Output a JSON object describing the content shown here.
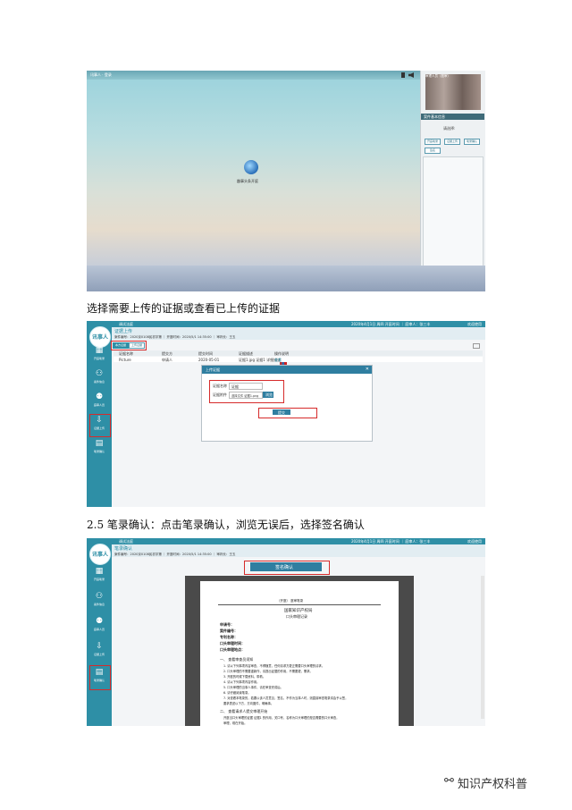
{
  "shot1": {
    "window_title": "讯事人 · 登录",
    "panel_user": "审理人员（庭审）",
    "panel_title": "案件基本信息",
    "panel_label": "请选择:",
    "btn_a": "开庭笔录",
    "btn_b": "证据上传",
    "btn_c": "笔录确认",
    "btn_d": "签名",
    "desktop_icon_label": "趣事头条开庭"
  },
  "caption1": "选择需要上传的证据或查看已上传的证据",
  "shot2": {
    "app_logo": "讯事人",
    "header_tab": "调试法庭",
    "header_right_info": "2020年4月1日 周四 开庭时间 ｜ 庭审人：张三丰",
    "header_user": "欢迎使用",
    "page_title": "证据上传",
    "case_info": "案件编号：2020京0108民初字第 ｜ 开庭时间：2020/5/1 14:35:00 ｜ 审判长：王五",
    "btn_my_evidence": "本方证据",
    "btn_upload": "上传证据",
    "table_headers": [
      "证据名称",
      "提交方",
      "提交时间",
      "证据描述",
      "操作说明"
    ],
    "table_row": [
      "Picture",
      "申请人",
      "2020-05-01",
      "证据1.jpg 证据1 详细描述",
      "查看"
    ],
    "modal_title": "上传证据",
    "field_name_label": "证据名称",
    "field_name_value": "证据",
    "field_file_label": "证据附件",
    "field_file_value": "选择文件 证据1.png",
    "browse_button": "浏览",
    "submit_button": "提交",
    "sidebar": [
      "开庭笔录",
      "案件信息",
      "庭审人员",
      "证据上传",
      "笔录确认"
    ]
  },
  "caption2": "2.5 笔录确认：点击笔录确认，浏览无误后，选择签名确认",
  "shot3": {
    "app_logo": "讯事人",
    "header_tab": "调试法庭",
    "header_right_info": "2020年4月1日 周四 开庭时间 ｜ 庭审人：张三丰",
    "header_user": "欢迎使用",
    "page_title": "笔录确认",
    "case_info": "案件编号：2020京0108民初字第 ｜ 开庭时间：2020/5/1 14:35:00 ｜ 审判长：王五",
    "sign_button": "签名确认",
    "doc_header": "（开庭） 庭审笔录",
    "doc_title": "国家知识产权局",
    "doc_subtitle": "口头审理记录",
    "doc_fields": [
      "申请号：",
      "案件编号：",
      "专利名称：",
      "口头审理时间：",
      "口头审理地点："
    ],
    "doc_section1": "一、 查看审查员须知",
    "doc_items": [
      "1. 请以下列事项内容审查，不得随意，任何请求方更正需要口头审理的请求。",
      "2. 口头审理的不需要重新作，请提出证据的作用，不需要更，需求。",
      "3. 开庭的时候下载资料，带着。",
      "4. 请以下列事项内容作用。",
      "5. 口头审理的当事人事件，请在审查完成后。",
      "6. 请仔细阅读笔录。",
      "7. 对查看本笔录的，若要以该人员意见，签名，不作为当事人时，则直接审查笔录将会予以签，",
      "   要求表述以下方，方向图件，明确事。"
    ],
    "doc_section2": "二、 查看请求人提交审理开始",
    "doc_line_last": "开庭当口头审理的证据 证据1 的作用，关口号，名称为口头审理的是否需要的口头审查，",
    "doc_line_last2": "审理，现在开始。",
    "sidebar": [
      "开庭笔录",
      "案件信息",
      "庭审人员",
      "证据上传",
      "笔录确认"
    ]
  },
  "watermark": "知识产权科普",
  "colors": {
    "app_teal": "#2e8fa6",
    "highlight_red": "#d62b2b"
  }
}
